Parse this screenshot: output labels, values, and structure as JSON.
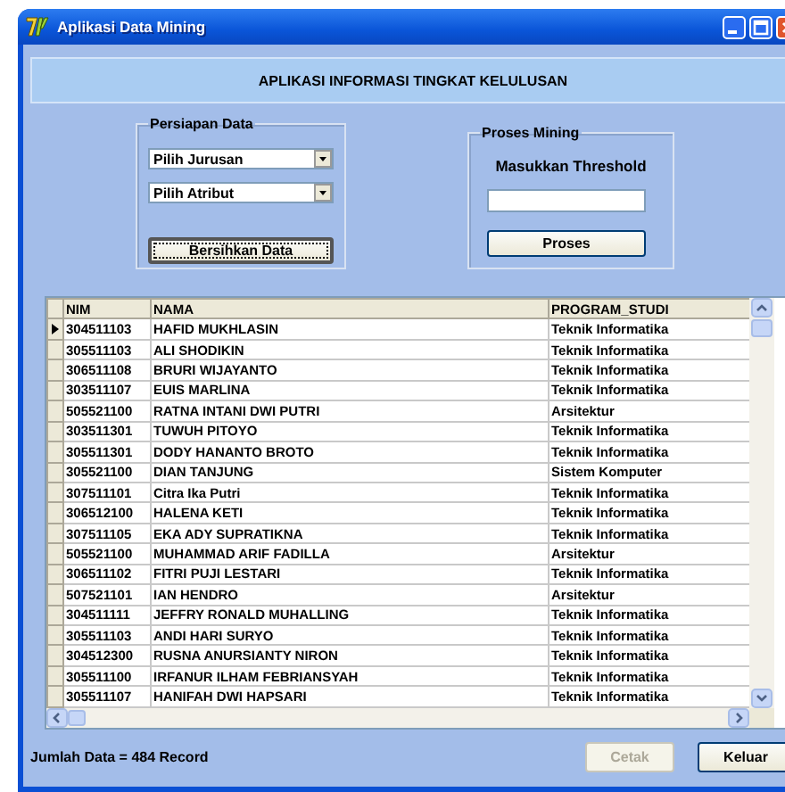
{
  "window": {
    "title": "Aplikasi Data Mining"
  },
  "header": {
    "text": "APLIKASI INFORMASI TINGKAT KELULUSAN"
  },
  "persiapan": {
    "title": "Persiapan Data",
    "combos": [
      {
        "value": "Pilih Jurusan"
      },
      {
        "value": "Pilih Atribut"
      }
    ],
    "button": {
      "label": "Bersihkan Data",
      "focused": true
    }
  },
  "proses": {
    "title": "Proses Mining",
    "label": "Masukkan Threshold",
    "button": {
      "label": "Proses",
      "focused": false
    }
  },
  "grid": {
    "columns": [
      "NIM",
      "NAMA",
      "PROGRAM_STUDI"
    ],
    "rows": [
      {
        "nim": "304511103",
        "nama": "HAFID MUKHLASIN",
        "prodi": "Teknik Informatika",
        "selected": true
      },
      {
        "nim": "305511103",
        "nama": "ALI SHODIKIN",
        "prodi": "Teknik Informatika",
        "selected": false
      },
      {
        "nim": "306511108",
        "nama": "BRURI WIJAYANTO",
        "prodi": "Teknik Informatika",
        "selected": false
      },
      {
        "nim": "303511107",
        "nama": "EUIS MARLINA",
        "prodi": "Teknik Informatika",
        "selected": false
      },
      {
        "nim": "505521100",
        "nama": "RATNA INTANI DWI PUTRI",
        "prodi": "Arsitektur",
        "selected": false
      },
      {
        "nim": "303511301",
        "nama": "TUWUH PITOYO",
        "prodi": "Teknik Informatika",
        "selected": false
      },
      {
        "nim": "305511301",
        "nama": "DODY HANANTO BROTO",
        "prodi": "Teknik Informatika",
        "selected": false
      },
      {
        "nim": "305521100",
        "nama": "DIAN TANJUNG",
        "prodi": "Sistem Komputer",
        "selected": false
      },
      {
        "nim": "307511101",
        "nama": "Citra Ika Putri",
        "prodi": "Teknik Informatika",
        "selected": false
      },
      {
        "nim": "306512100",
        "nama": "HALENA KETI",
        "prodi": "Teknik Informatika",
        "selected": false
      },
      {
        "nim": "307511105",
        "nama": "EKA ADY SUPRATIKNA",
        "prodi": "Teknik Informatika",
        "selected": false
      },
      {
        "nim": "505521100",
        "nama": "MUHAMMAD ARIF FADILLA",
        "prodi": "Arsitektur",
        "selected": false
      },
      {
        "nim": "306511102",
        "nama": "FITRI PUJI LESTARI",
        "prodi": "Teknik Informatika",
        "selected": false
      },
      {
        "nim": "507521101",
        "nama": "IAN HENDRO",
        "prodi": "Arsitektur",
        "selected": false
      },
      {
        "nim": "304511111",
        "nama": "JEFFRY RONALD MUHALLING",
        "prodi": "Teknik Informatika",
        "selected": false
      },
      {
        "nim": "305511103",
        "nama": "ANDI HARI SURYO",
        "prodi": "Teknik Informatika",
        "selected": false
      },
      {
        "nim": "304512300",
        "nama": "RUSNA ANURSIANTY NIRON",
        "prodi": "Teknik Informatika",
        "selected": false
      },
      {
        "nim": "305511100",
        "nama": "IRFANUR ILHAM FEBRIANSYAH",
        "prodi": "Teknik Informatika",
        "selected": false
      },
      {
        "nim": "305511107",
        "nama": "HANIFAH DWI HAPSARI",
        "prodi": "Teknik Informatika",
        "selected": false
      }
    ]
  },
  "footer": {
    "count": "Jumlah Data = 484 Record",
    "buttons": [
      {
        "label": "Cetak",
        "disabled": true
      },
      {
        "label": "Keluar",
        "disabled": false
      }
    ]
  }
}
